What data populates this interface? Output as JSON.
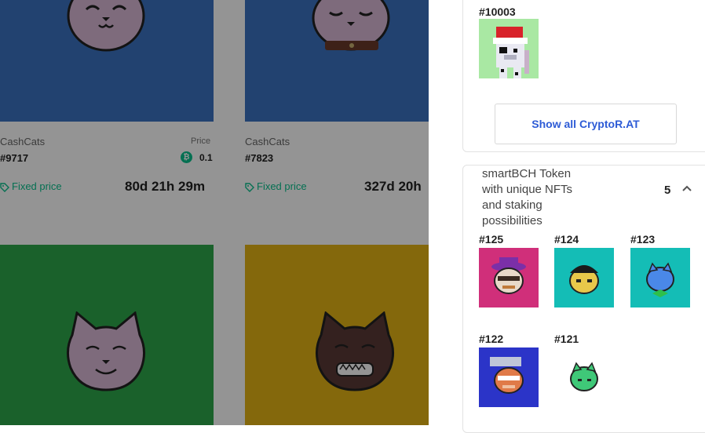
{
  "cards": [
    {
      "collection": "CashCats",
      "token_id": "#9717",
      "price_label": "Price",
      "price": "0.1",
      "sale_type": "Fixed price",
      "time_left": "80d 21h 29m"
    },
    {
      "collection": "CashCats",
      "token_id": "#7823",
      "sale_type": "Fixed price",
      "time_left": "327d 20h"
    }
  ],
  "panel": {
    "cryptorat": {
      "items": [
        {
          "id": "#10003"
        }
      ],
      "show_all_label": "Show all CryptoR.AT"
    },
    "smartbch": {
      "description": "smartBCH Token with unique NFTs and staking possibilities",
      "count": "5",
      "items": [
        {
          "id": "#125"
        },
        {
          "id": "#124"
        },
        {
          "id": "#123"
        },
        {
          "id": "#122"
        },
        {
          "id": "#121"
        }
      ]
    }
  }
}
